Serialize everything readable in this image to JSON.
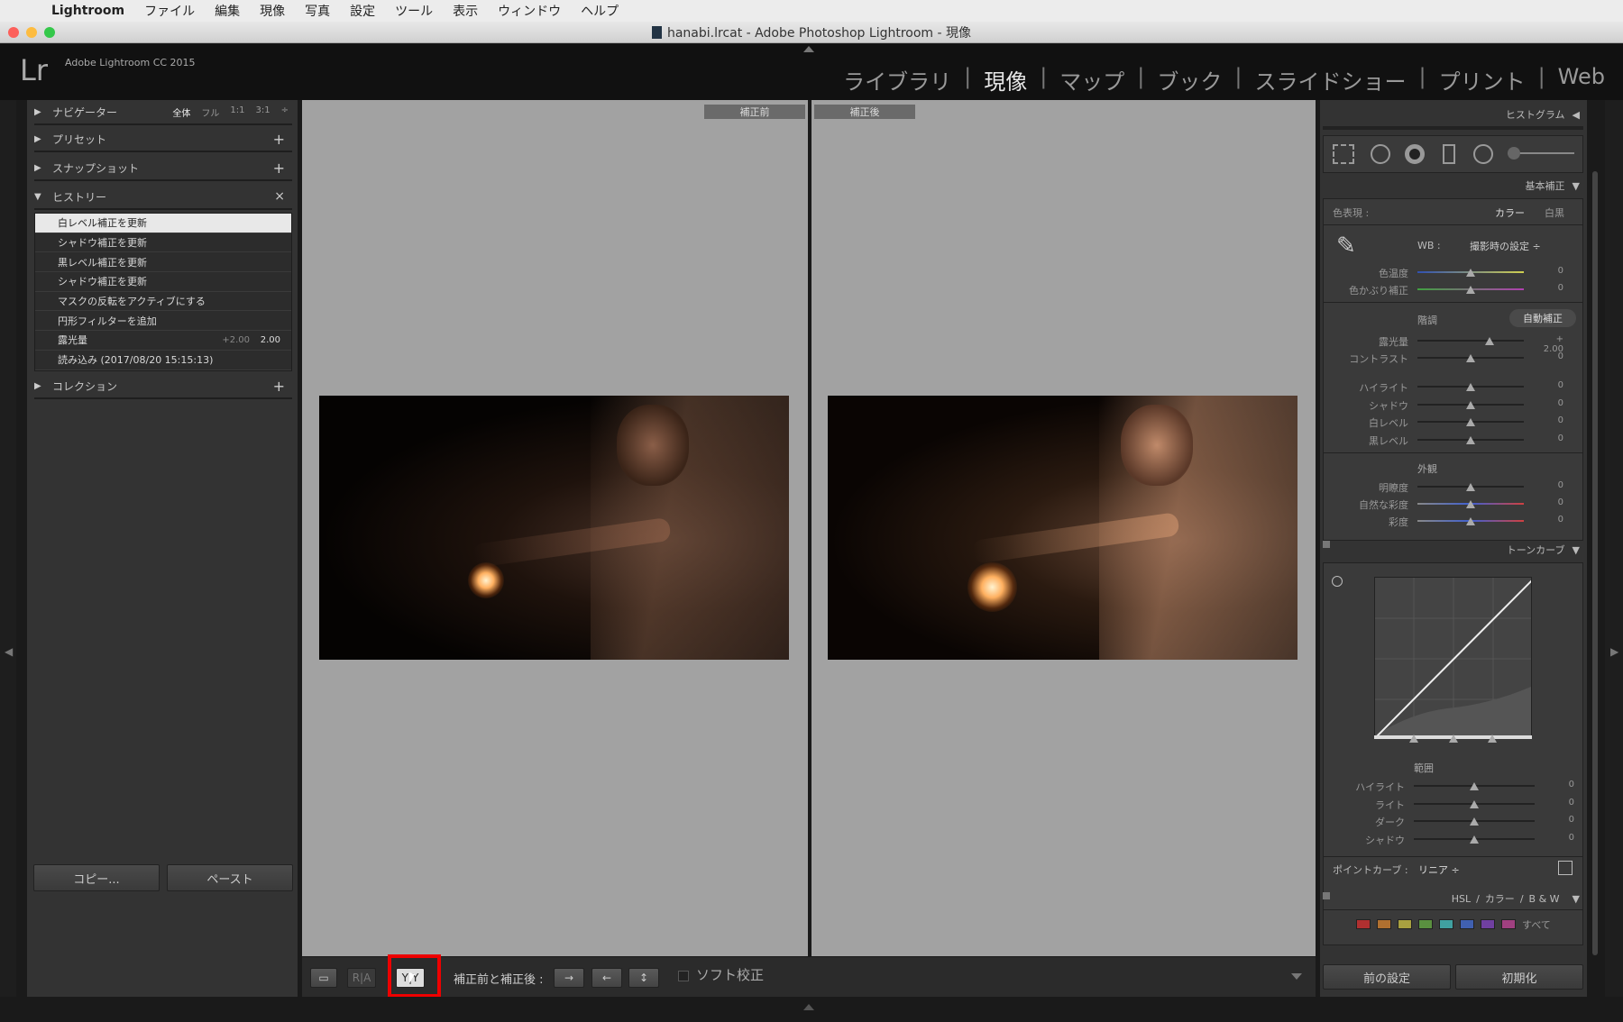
{
  "menubar": {
    "app": "Lightroom",
    "items": [
      "ファイル",
      "編集",
      "現像",
      "写真",
      "設定",
      "ツール",
      "表示",
      "ウィンドウ",
      "ヘルプ"
    ]
  },
  "window": {
    "title": "hanabi.lrcat - Adobe Photoshop Lightroom - 現像"
  },
  "header": {
    "logo": "Lr",
    "version": "Adobe Lightroom CC 2015",
    "modules": [
      "ライブラリ",
      "現像",
      "マップ",
      "ブック",
      "スライドショー",
      "プリント",
      "Web"
    ],
    "active_module": "現像"
  },
  "left_panel": {
    "navigator": {
      "label": "ナビゲーター",
      "options": [
        "全体",
        "フル",
        "1:1",
        "3:1"
      ],
      "active_option": "全体"
    },
    "presets": {
      "label": "プリセット"
    },
    "snapshots": {
      "label": "スナップショット"
    },
    "history": {
      "label": "ヒストリー",
      "items": [
        {
          "label": "白レベル補正を更新",
          "v1": "",
          "v2": ""
        },
        {
          "label": "シャドウ補正を更新",
          "v1": "",
          "v2": ""
        },
        {
          "label": "黒レベル補正を更新",
          "v1": "",
          "v2": ""
        },
        {
          "label": "シャドウ補正を更新",
          "v1": "",
          "v2": ""
        },
        {
          "label": "マスクの反転をアクティブにする",
          "v1": "",
          "v2": ""
        },
        {
          "label": "円形フィルターを追加",
          "v1": "",
          "v2": ""
        },
        {
          "label": "露光量",
          "v1": "+2.00",
          "v2": "2.00"
        },
        {
          "label": "読み込み (2017/08/20 15:15:13)",
          "v1": "",
          "v2": ""
        }
      ],
      "selected_index": 0
    },
    "collections": {
      "label": "コレクション"
    },
    "copy_button": "コピー...",
    "paste_button": "ペースト"
  },
  "center": {
    "before_label": "補正前",
    "after_label": "補正後"
  },
  "toolbar": {
    "view_loupe": "▭",
    "view_ra": "R|A",
    "view_yy": "Y|Y",
    "before_after_label": "補正前と補正後 :",
    "swap_buttons": [
      "→",
      "←",
      "↕"
    ],
    "soft_proof_label": "ソフト校正"
  },
  "right_panel": {
    "histogram_label": "ヒストグラム",
    "basic_label": "基本補正",
    "treatment_label": "色表現 :",
    "treatment_color": "カラー",
    "treatment_bw": "白黒",
    "wb_label": "WB :",
    "wb_value": "撮影時の設定 ÷",
    "wb_sliders": [
      {
        "label": "色温度",
        "value": "0"
      },
      {
        "label": "色かぶり補正",
        "value": "0"
      }
    ],
    "tone_label": "階調",
    "auto_label": "自動補正",
    "tone_sliders": [
      {
        "label": "露光量",
        "value": "+ 2.00"
      },
      {
        "label": "コントラスト",
        "value": "0"
      }
    ],
    "tone_sliders2": [
      {
        "label": "ハイライト",
        "value": "0"
      },
      {
        "label": "シャドウ",
        "value": "0"
      },
      {
        "label": "白レベル",
        "value": "0"
      },
      {
        "label": "黒レベル",
        "value": "0"
      }
    ],
    "presence_label": "外観",
    "presence_sliders": [
      {
        "label": "明瞭度",
        "value": "0"
      },
      {
        "label": "自然な彩度",
        "value": "0"
      },
      {
        "label": "彩度",
        "value": "0"
      }
    ],
    "tonecurve_label": "トーンカーブ",
    "region_label": "範囲",
    "region_sliders": [
      {
        "label": "ハイライト",
        "value": "0"
      },
      {
        "label": "ライト",
        "value": "0"
      },
      {
        "label": "ダーク",
        "value": "0"
      },
      {
        "label": "シャドウ",
        "value": "0"
      }
    ],
    "point_curve_label": "ポイントカーブ :",
    "point_curve_value": "リニア ÷",
    "hsl_label": "HSL",
    "hsl_color": "カラー",
    "hsl_bw": "B & W",
    "all_label": "すべて",
    "previous_button": "前の設定",
    "reset_button": "初期化"
  }
}
